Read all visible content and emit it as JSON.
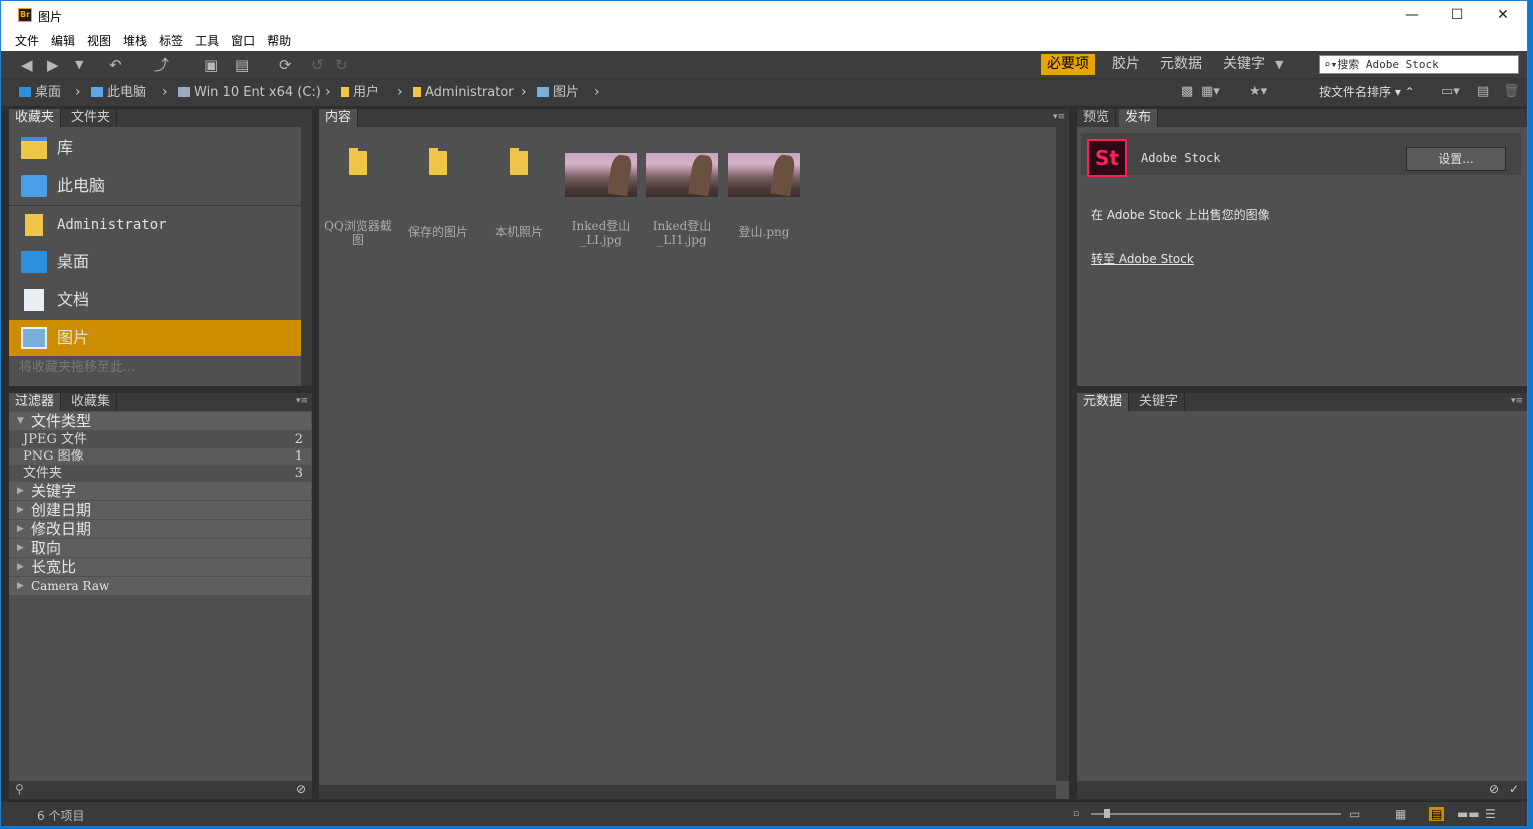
{
  "window": {
    "title": "图片",
    "app_icon": "Br",
    "controls": {
      "minimize": "—",
      "maximize": "☐",
      "close": "✕"
    }
  },
  "menu": [
    "文件",
    "编辑",
    "视图",
    "堆栈",
    "标签",
    "工具",
    "窗口",
    "帮助"
  ],
  "toolbar": {
    "workspaces": [
      "必要项",
      "胶片",
      "元数据",
      "关键字"
    ],
    "workspace_more": "▼",
    "search_placeholder": "搜索 Adobe Stock",
    "search_icon": "⌕▾"
  },
  "path": {
    "crumbs": [
      "桌面",
      "此电脑",
      "Win 10 Ent x64 (C:)",
      "用户",
      "Administrator",
      "图片"
    ],
    "sort_label": "按文件名排序"
  },
  "favorites": {
    "tabs": [
      "收藏夹",
      "文件夹"
    ],
    "items": [
      "库",
      "此电脑",
      "Administrator",
      "桌面",
      "文档",
      "图片"
    ],
    "hint": "将收藏夹拖移至此..."
  },
  "filter": {
    "tabs": [
      "过滤器",
      "收藏集"
    ],
    "file_type": "文件类型",
    "rows": [
      {
        "label": "JPEG 文件",
        "count": "2"
      },
      {
        "label": "PNG 图像",
        "count": "1"
      },
      {
        "label": "文件夹",
        "count": "3"
      }
    ],
    "sections": [
      "关键字",
      "创建日期",
      "修改日期",
      "取向",
      "长宽比",
      "Camera Raw"
    ]
  },
  "content": {
    "tab": "内容",
    "items": [
      {
        "type": "folder",
        "label": "QQ浏览器截图"
      },
      {
        "type": "folder",
        "label": "保存的图片"
      },
      {
        "type": "folder",
        "label": "本机照片"
      },
      {
        "type": "image",
        "label": "Inked登山_LI.jpg"
      },
      {
        "type": "image",
        "label": "Inked登山_LI1.jpg"
      },
      {
        "type": "image",
        "label": "登山.png"
      }
    ]
  },
  "publish": {
    "tabs": [
      "预览",
      "发布"
    ],
    "stock_logo": "St",
    "stock_name": "Adobe Stock",
    "settings_button": "设置...",
    "sell_text": "在 Adobe Stock 上出售您的图像",
    "goto_link": "转至 Adobe Stock"
  },
  "metadata": {
    "tabs": [
      "元数据",
      "关键字"
    ]
  },
  "status": {
    "items_count": "6 个项目"
  },
  "colors": {
    "accent": "#e8a400",
    "selected": "#cc8e00",
    "stock": "#ff1f5a"
  }
}
